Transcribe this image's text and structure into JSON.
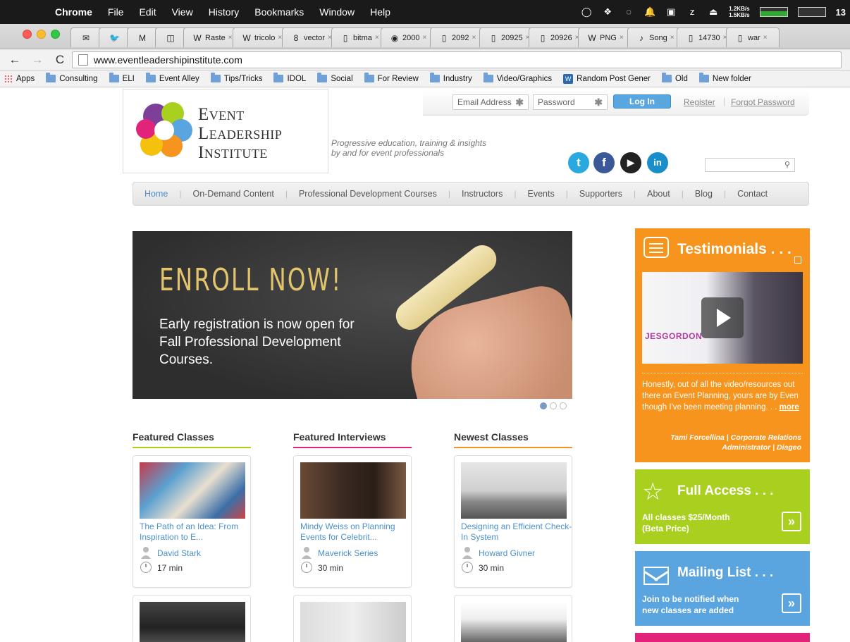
{
  "macbar": {
    "app": "Chrome",
    "menus": [
      "File",
      "Edit",
      "View",
      "History",
      "Bookmarks",
      "Window",
      "Help"
    ],
    "net_up": "1.2KB/s",
    "net_down": "1.5KB/s",
    "clock": "13"
  },
  "tabs": [
    {
      "fav": "✉",
      "label": ""
    },
    {
      "fav": "🐦",
      "label": ""
    },
    {
      "fav": "M",
      "label": ""
    },
    {
      "fav": "◫",
      "label": ""
    },
    {
      "fav": "W",
      "label": "Raste"
    },
    {
      "fav": "W",
      "label": "tricolo"
    },
    {
      "fav": "8",
      "label": "vector"
    },
    {
      "fav": "▯",
      "label": "bitma"
    },
    {
      "fav": "◉",
      "label": "2000"
    },
    {
      "fav": "▯",
      "label": "2092"
    },
    {
      "fav": "▯",
      "label": "20925"
    },
    {
      "fav": "▯",
      "label": "20926"
    },
    {
      "fav": "W",
      "label": "PNG"
    },
    {
      "fav": "♪",
      "label": "Song"
    },
    {
      "fav": "▯",
      "label": "14730"
    },
    {
      "fav": "▯",
      "label": "war"
    }
  ],
  "toolbar": {
    "url": "www.eventleadershipinstitute.com"
  },
  "bookmarks": [
    {
      "label": "Apps",
      "type": "apps"
    },
    {
      "label": "Consulting",
      "type": "folder"
    },
    {
      "label": "ELI",
      "type": "folder"
    },
    {
      "label": "Event Alley",
      "type": "folder"
    },
    {
      "label": "Tips/Tricks",
      "type": "folder"
    },
    {
      "label": "IDOL",
      "type": "folder"
    },
    {
      "label": "Social",
      "type": "folder"
    },
    {
      "label": "For Review",
      "type": "folder"
    },
    {
      "label": "Industry",
      "type": "folder"
    },
    {
      "label": "Video/Graphics",
      "type": "folder"
    },
    {
      "label": "Random Post Gener",
      "type": "wp"
    },
    {
      "label": "Old",
      "type": "folder"
    },
    {
      "label": "New folder",
      "type": "folder"
    }
  ],
  "site": {
    "logo": {
      "line1": "Event",
      "line2": "Leadership",
      "line3": "Institute"
    },
    "tagline1": "Progressive education, training & insights",
    "tagline2": "by and for event professionals",
    "login": {
      "email_placeholder": "Email Address",
      "password_placeholder": "Password",
      "login_label": "Log In",
      "register_label": "Register",
      "separator": "|",
      "forgot_label": "Forgot Password"
    },
    "social": [
      {
        "name": "twitter",
        "glyph": "t",
        "color": "#2aa9e0"
      },
      {
        "name": "facebook",
        "glyph": "f",
        "color": "#3b5998"
      },
      {
        "name": "youtube",
        "glyph": "▶",
        "color": "#222222"
      },
      {
        "name": "linkedin",
        "glyph": "in",
        "color": "#1a8ec9"
      }
    ],
    "nav": [
      "Home",
      "On-Demand Content",
      "Professional Development Courses",
      "Instructors",
      "Events",
      "Supporters",
      "About",
      "Blog",
      "Contact"
    ],
    "nav_active": 0,
    "hero": {
      "title": "ENROLL NOW!",
      "sub": "Early registration is now open for Fall Professional Development Courses."
    },
    "slider_active": 0,
    "columns": [
      {
        "heading": "Featured Classes",
        "color": "#a9cf1f",
        "card": {
          "title": "The Path of an Idea: From Inspiration to E...",
          "author": "David Stark",
          "duration": "17 min"
        }
      },
      {
        "heading": "Featured Interviews",
        "color": "#e2237a",
        "card": {
          "title": "Mindy Weiss on Planning Events for Celebrit...",
          "author": "Maverick Series",
          "duration": "30 min"
        }
      },
      {
        "heading": "Newest Classes",
        "color": "#f7941d",
        "card": {
          "title": "Designing an Efficient Check-In System",
          "author": "Howard Givner",
          "duration": "30 min"
        }
      }
    ],
    "testimonials": {
      "heading": "Testimonials . . .",
      "video_brand": "JESGORDON",
      "quote": "Honestly, out of all the video/resources out there on Event Planning, yours are by Even though I've been meeting planning. . .",
      "more": "more",
      "cite1": "Tami Forcellina | Corporate Relations",
      "cite2": "Administrator | Diageo"
    },
    "full_access": {
      "heading": "Full Access . . .",
      "text1": "All classes $25/Month",
      "text2": "(Beta Price)",
      "arrow": "»"
    },
    "mailing": {
      "heading": "Mailing List . . .",
      "text1": "Join to be notified when",
      "text2": "new classes are added",
      "arrow": "»"
    }
  }
}
